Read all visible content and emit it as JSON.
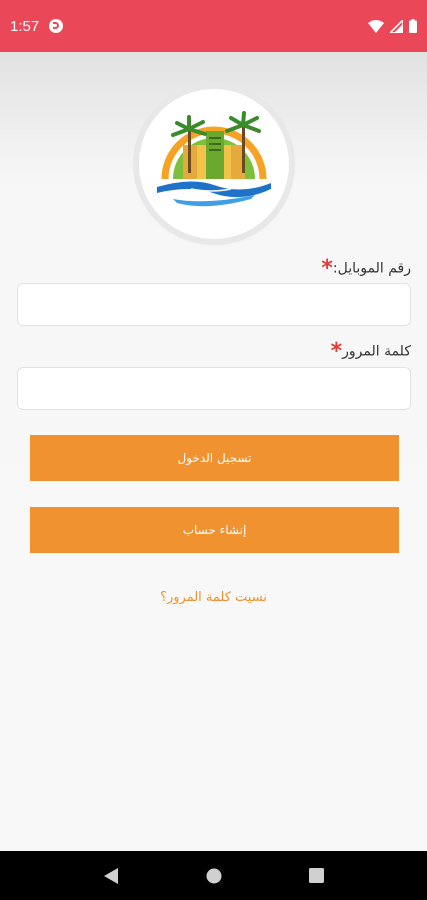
{
  "status_bar": {
    "time": "1:57",
    "icons": [
      "app-notification-icon",
      "wifi-icon",
      "signal-icon",
      "battery-icon"
    ]
  },
  "logo": {
    "alt_icon": "resort-logo-icon"
  },
  "form": {
    "mobile_label": "رقم الموبايل:",
    "mobile_value": "",
    "password_label": "كلمة المرور",
    "password_value": "",
    "required_marker": "*"
  },
  "buttons": {
    "login_label": "تسجيل الدخول",
    "register_label": "إنشاء حساب"
  },
  "links": {
    "forgot_password": "نسيت كلمة المرور؟"
  },
  "colors": {
    "status_bar": "#ea4858",
    "button": "#f19231",
    "link": "#f19231",
    "required": "#e53935"
  },
  "nav_bar": {
    "icons": [
      "back-icon",
      "home-icon",
      "recents-icon"
    ]
  }
}
